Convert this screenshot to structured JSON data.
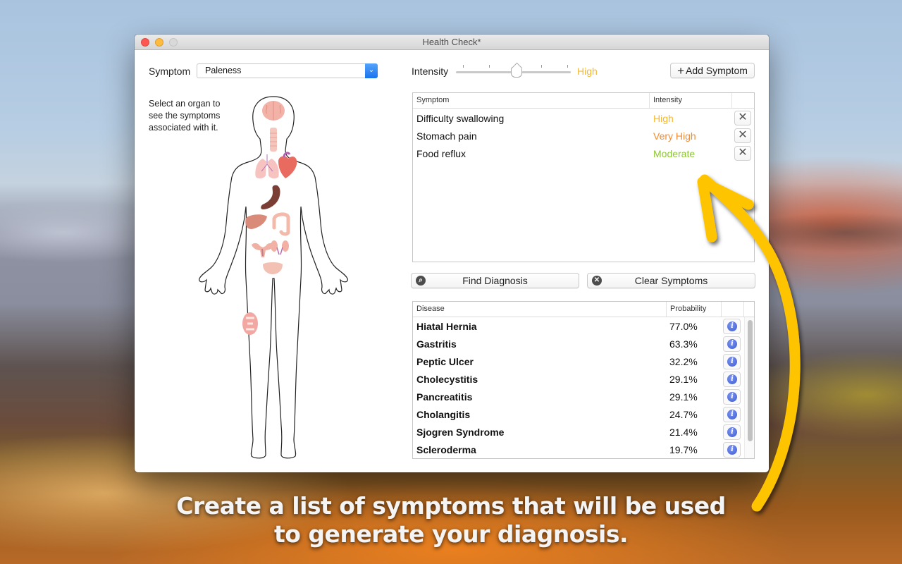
{
  "window": {
    "title": "Health Check*"
  },
  "symptom_picker": {
    "label": "Symptom",
    "selected": "Paleness",
    "chevron": "⌄"
  },
  "hint_text": "Select an organ to see the symptoms associated with it.",
  "organs": [
    "brain",
    "throat",
    "lungs",
    "heart",
    "stomach",
    "liver",
    "intestine",
    "uterus",
    "kidneys",
    "bladder",
    "knee-joint"
  ],
  "intensity": {
    "label": "Intensity",
    "value_label": "High",
    "level_index": 2,
    "levels_count": 5,
    "value_color": "#f5b82e"
  },
  "add_symptom": {
    "icon": "+",
    "label": "Add Symptom"
  },
  "symptom_table": {
    "headers": {
      "symptom": "Symptom",
      "intensity": "Intensity"
    },
    "rows": [
      {
        "symptom": "Difficulty swallowing",
        "intensity": "High",
        "color": "#f5b82e",
        "remove": "✕"
      },
      {
        "symptom": "Stomach pain",
        "intensity": "Very High",
        "color": "#f28b30",
        "remove": "✕"
      },
      {
        "symptom": "Food reflux",
        "intensity": "Moderate",
        "color": "#8cc630",
        "remove": "✕"
      }
    ]
  },
  "actions": {
    "find_icon": "⌕",
    "find_label": "Find Diagnosis",
    "clear_icon": "✕",
    "clear_label": "Clear Symptoms"
  },
  "disease_table": {
    "headers": {
      "disease": "Disease",
      "probability": "Probability"
    },
    "rows": [
      {
        "disease": "Hiatal Hernia",
        "probability": "77.0%",
        "info": "i"
      },
      {
        "disease": "Gastritis",
        "probability": "63.3%",
        "info": "i"
      },
      {
        "disease": "Peptic Ulcer",
        "probability": "32.2%",
        "info": "i"
      },
      {
        "disease": "Cholecystitis",
        "probability": "29.1%",
        "info": "i"
      },
      {
        "disease": "Pancreatitis",
        "probability": "29.1%",
        "info": "i"
      },
      {
        "disease": "Cholangitis",
        "probability": "24.7%",
        "info": "i"
      },
      {
        "disease": "Sjogren Syndrome",
        "probability": "21.4%",
        "info": "i"
      },
      {
        "disease": "Scleroderma",
        "probability": "19.7%",
        "info": "i"
      }
    ]
  },
  "caption": {
    "line1": "Create a list of symptoms that will be used",
    "line2": "to generate your diagnosis."
  },
  "colors": {
    "accent_arrow": "#ffc400",
    "popup_blue": "#1a73ee",
    "info_blue": "#3d5dd4"
  }
}
